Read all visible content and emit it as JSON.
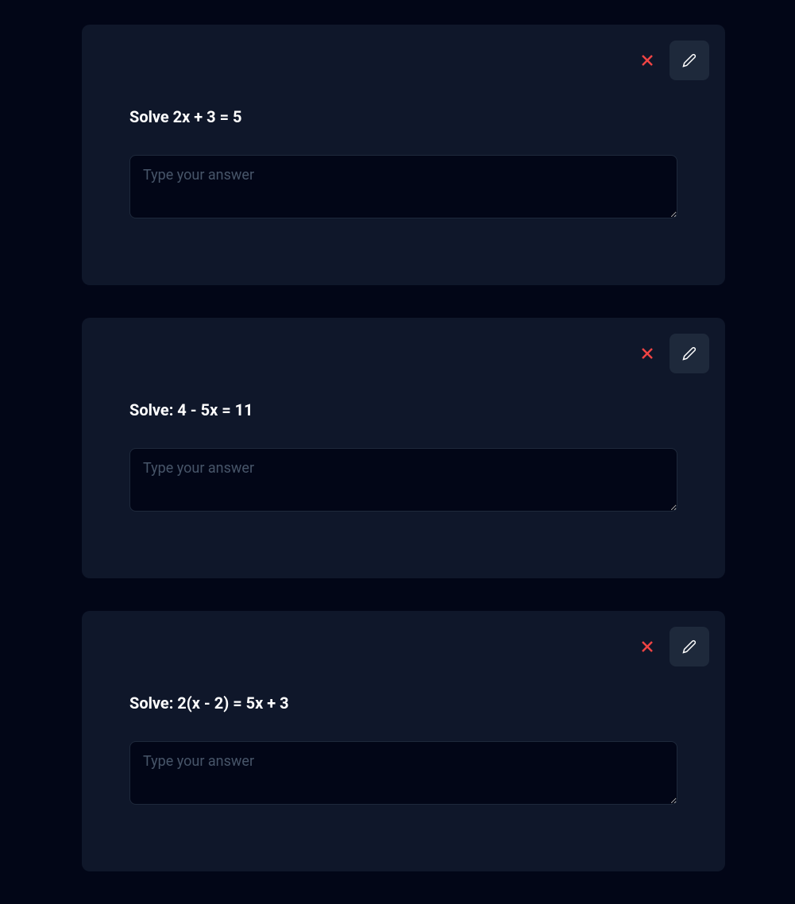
{
  "questions": [
    {
      "title": "Solve 2x + 3 = 5",
      "placeholder": "Type your answer"
    },
    {
      "title": "Solve: 4 - 5x = 11",
      "placeholder": "Type your answer"
    },
    {
      "title": "Solve: 2(x - 2) = 5x + 3",
      "placeholder": "Type your answer"
    }
  ]
}
